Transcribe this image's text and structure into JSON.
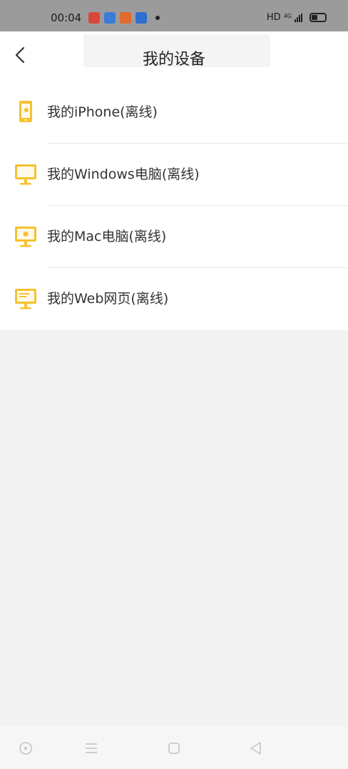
{
  "status_bar": {
    "time": "00:04",
    "hd": "HD",
    "net_type": "4G",
    "app_icons": [
      {
        "name": "app-icon-1",
        "color": "#d9463a"
      },
      {
        "name": "app-icon-2",
        "color": "#3a7bd5"
      },
      {
        "name": "app-icon-3",
        "color": "#e26a2c"
      },
      {
        "name": "app-icon-4",
        "color": "#2d6fd0"
      }
    ]
  },
  "header": {
    "title": "我的设备",
    "back_icon": "chevron-left-icon"
  },
  "accent_color": "#f5c12e",
  "devices": [
    {
      "label": "我的iPhone(离线)",
      "icon": "phone-icon"
    },
    {
      "label": "我的Windows电脑(离线)",
      "icon": "monitor-icon"
    },
    {
      "label": "我的Mac电脑(离线)",
      "icon": "monitor-apple-icon"
    },
    {
      "label": "我的Web网页(离线)",
      "icon": "monitor-web-icon"
    }
  ],
  "bottom_nav": [
    "circle-home-icon",
    "menu-icon",
    "square-recents-icon",
    "triangle-back-icon"
  ]
}
